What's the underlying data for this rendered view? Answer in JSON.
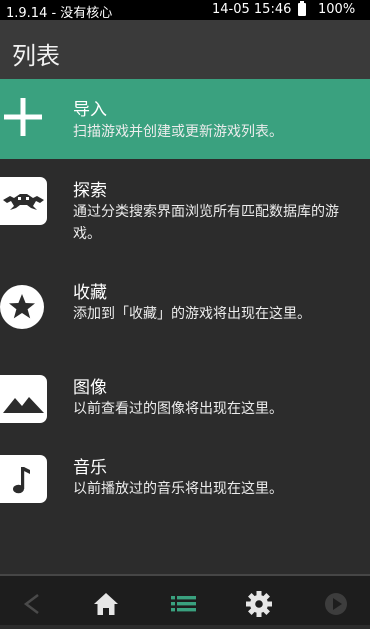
{
  "status": {
    "left_text": "1.9.14 - 没有核心",
    "time": "14-05 15:46",
    "battery": "100%"
  },
  "header": {
    "title": "列表"
  },
  "menu": [
    {
      "label": "导入",
      "desc": "扫描游戏并创建或更新游戏列表。",
      "icon": "plus-icon"
    },
    {
      "label": "探索",
      "desc": "通过分类搜索界面浏览所有匹配数据库的游戏。",
      "icon": "retroarch-invader-icon"
    },
    {
      "label": "收藏",
      "desc": "添加到「收藏」的游戏将出现在这里。",
      "icon": "star-icon"
    },
    {
      "label": "图像",
      "desc": "以前查看过的图像将出现在这里。",
      "icon": "image-icon"
    },
    {
      "label": "音乐",
      "desc": "以前播放过的音乐将出现在这里。",
      "icon": "music-note-icon"
    }
  ],
  "nav": {
    "items": [
      "back-icon",
      "home-icon",
      "list-icon",
      "gear-icon",
      "play-icon"
    ],
    "active": "list-icon"
  },
  "colors": {
    "accent": "#3aa17f",
    "background": "#2c2c2c",
    "header": "#3a3a3a",
    "navbar": "#1d1d1d"
  }
}
